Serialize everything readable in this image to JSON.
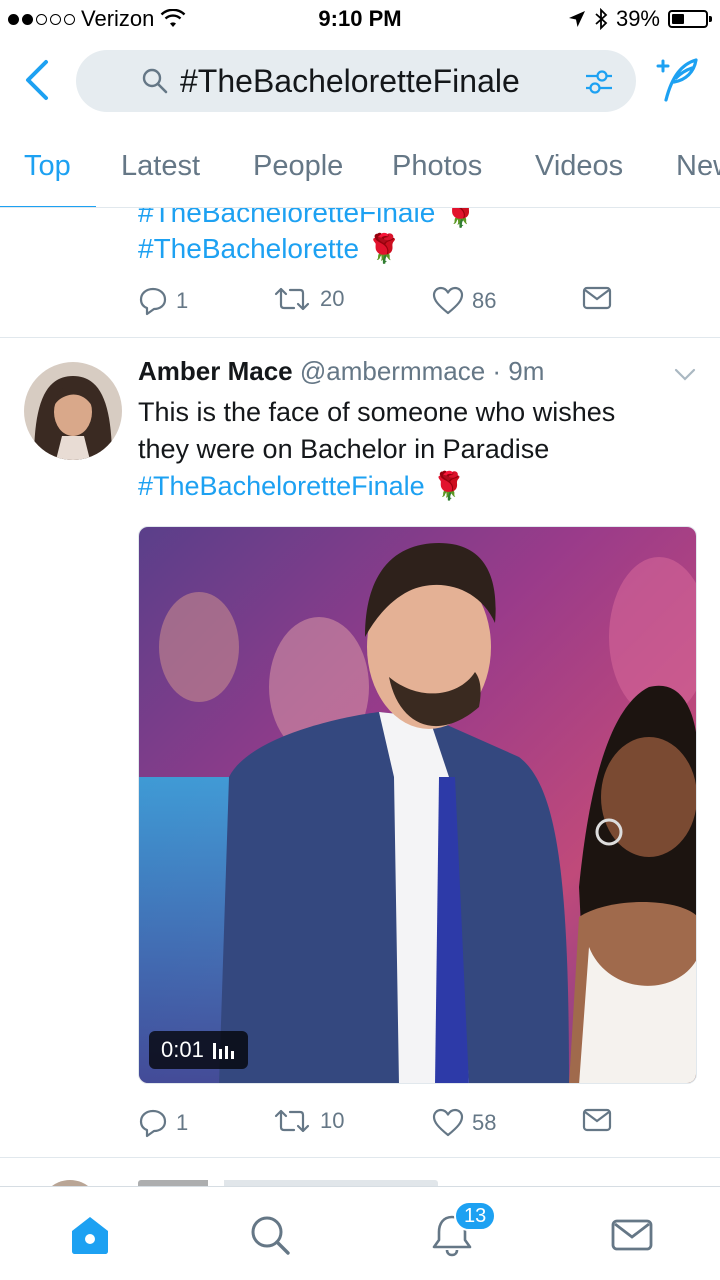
{
  "status_bar": {
    "carrier": "Verizon",
    "time": "9:10 PM",
    "battery": "39%",
    "battery_level": 0.39
  },
  "search": {
    "query": "#TheBacheloretteFinale"
  },
  "tabs": [
    {
      "label": "Top",
      "active": true
    },
    {
      "label": "Latest",
      "active": false
    },
    {
      "label": "People",
      "active": false
    },
    {
      "label": "Photos",
      "active": false
    },
    {
      "label": "Videos",
      "active": false
    },
    {
      "label": "New",
      "active": false
    }
  ],
  "partial_tweet": {
    "line1": "#TheBacheloretteFinale",
    "line2": "#TheBachelorette",
    "replies": "1",
    "retweets": "20",
    "likes": "86"
  },
  "tweet": {
    "name": "Amber Mace",
    "handle": "@ambermmace",
    "time": "9m",
    "text_line1": "This is the face of someone who wishes",
    "text_line2": "they were on Bachelor in Paradise",
    "hashtag": "#TheBacheloretteFinale",
    "video_time": "0:01",
    "replies": "1",
    "retweets": "10",
    "likes": "58"
  },
  "bottom_nav": {
    "notifications_count": "13"
  },
  "colors": {
    "accent": "#1da1f2",
    "muted": "#657786",
    "search_bg": "#e6ecf0"
  }
}
